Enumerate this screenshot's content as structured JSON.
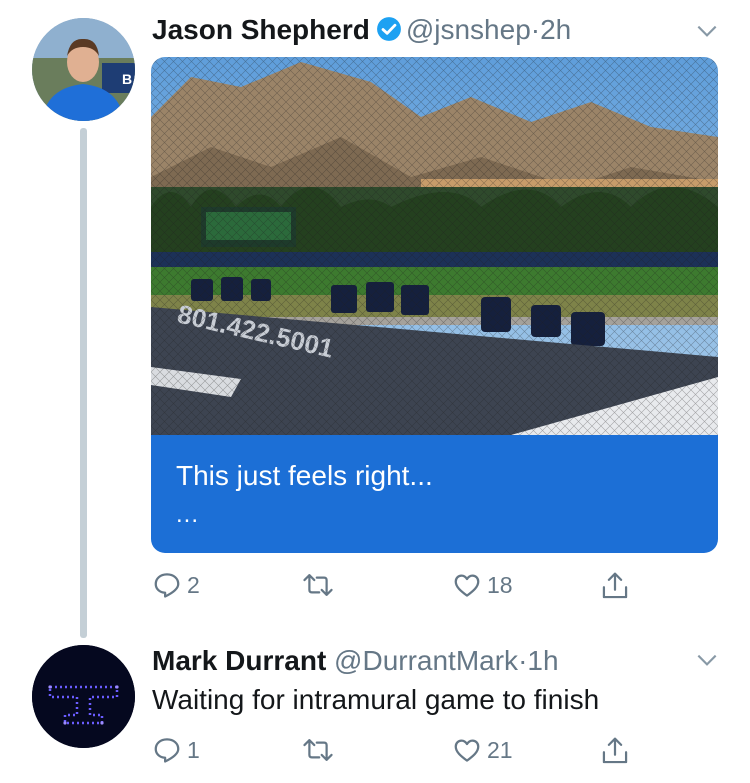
{
  "thread": [
    {
      "author": {
        "name": "Jason Shepherd",
        "handle": "@jsnshep",
        "verified": true
      },
      "separator": "·",
      "time": "2h",
      "card": {
        "text": "This just feels right...",
        "ellipsis": "..."
      },
      "actions": {
        "reply_count": "2",
        "retweet_count": "",
        "like_count": "18"
      }
    },
    {
      "author": {
        "name": "Mark Durrant",
        "handle": "@DurrantMark",
        "verified": false
      },
      "separator": "·",
      "time": "1h",
      "text": "Waiting for intramural game to finish",
      "actions": {
        "reply_count": "1",
        "retweet_count": "",
        "like_count": "21"
      }
    }
  ],
  "colors": {
    "card_background": "#1c6fd6",
    "verified_badge": "#1da1f2",
    "secondary_text": "#657786",
    "thread_line": "#c4cfd6"
  },
  "icons": [
    "verified-badge-icon",
    "chevron-down-icon",
    "reply-icon",
    "retweet-icon",
    "like-icon",
    "share-icon"
  ]
}
